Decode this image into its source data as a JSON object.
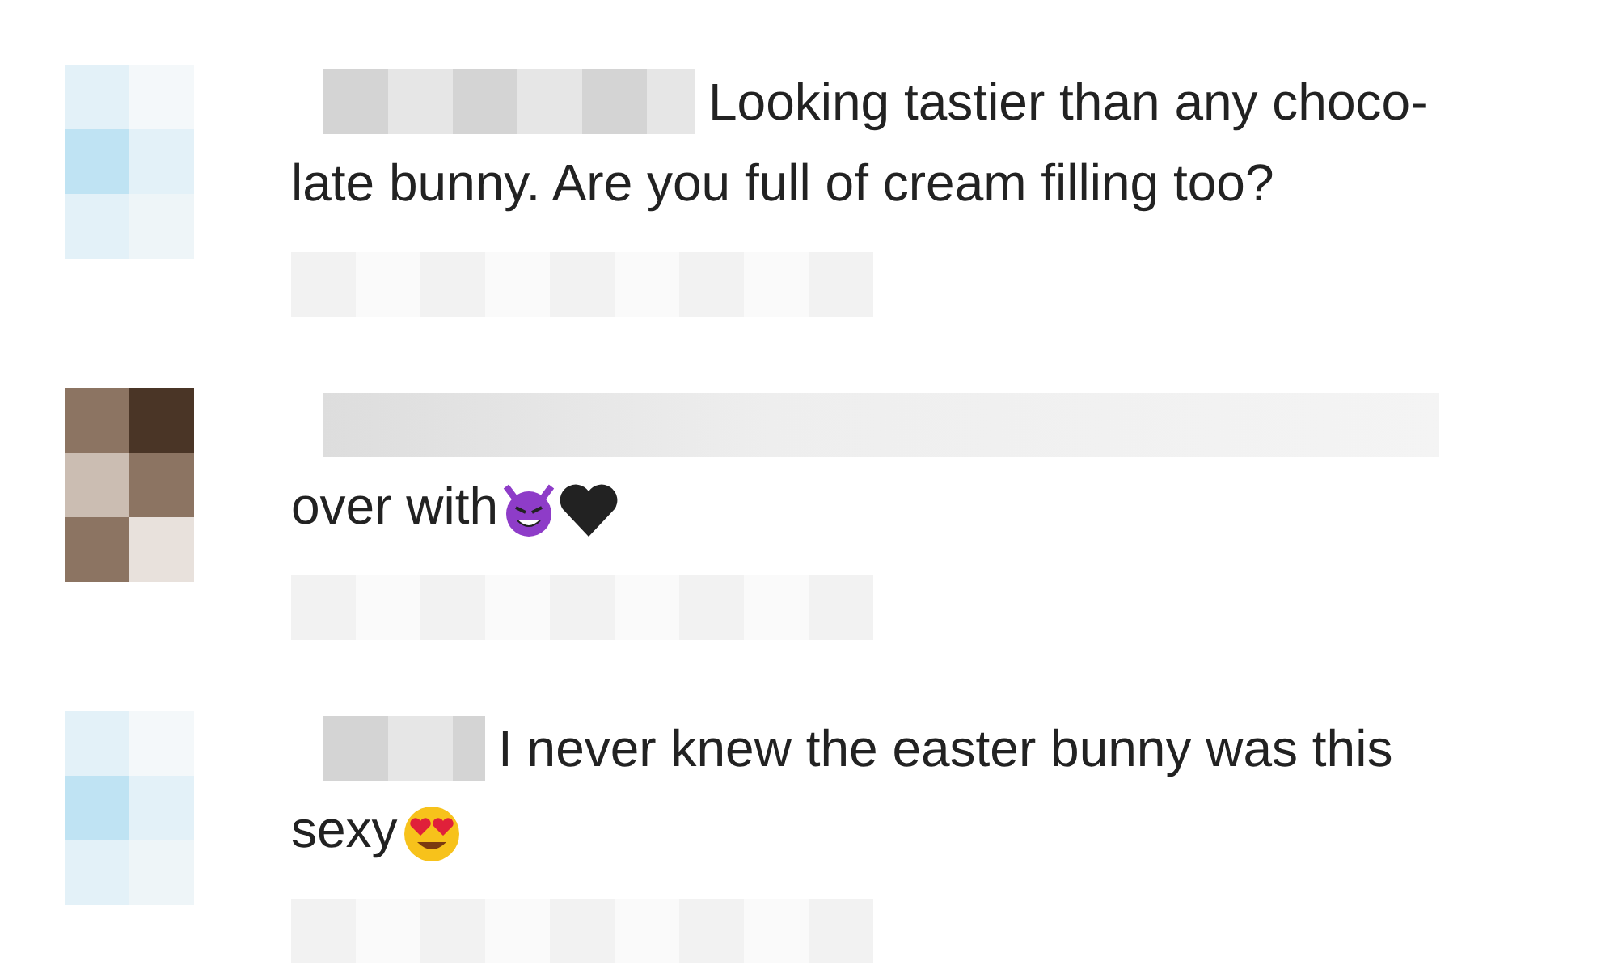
{
  "comments": [
    {
      "lines": [
        "Looking tastier than any choco-",
        "late bunny. Are you full of cream filling too?"
      ]
    },
    {
      "lines": [
        "over with"
      ],
      "emoji": [
        {
          "kind": "devil"
        },
        {
          "kind": "black-heart"
        }
      ]
    },
    {
      "lines": [
        "I never knew the easter bunny was this",
        "sexy"
      ],
      "emoji": [
        {
          "kind": "heart-eyes"
        }
      ]
    }
  ]
}
